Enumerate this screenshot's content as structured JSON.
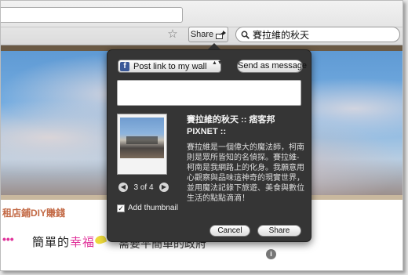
{
  "toolbar": {
    "share_label": "Share",
    "search_value": "賽拉維的秋天"
  },
  "page": {
    "blog_link": "租店鋪DIY賺錢",
    "pink_mark": "•••",
    "headline_pre": "簡單的",
    "headline_highlight": "幸福",
    "sub_head": "需要平簡單的政府",
    "info_icon_glyph": "i"
  },
  "popover": {
    "post_select_value": "Post link to my wall",
    "send_message_label": "Send as message",
    "message_placeholder": "",
    "link_title": "賽拉維的秋天 :: 痞客邦 PIXNET ::",
    "link_description": "賽拉維是一個偉大的魔法師，柯南則是眾所皆知的名偵探。賽拉維-柯南是我網路上的化身。我願意用心觀察與品味這神奇的現實世界，並用魔法記錄下旅遊、美食與數位生活的點點滴滴！",
    "thumb_counter": "3 of 4",
    "prev_glyph": "◀",
    "next_glyph": "▶",
    "add_thumbnail_label": "Add thumbnail",
    "add_thumbnail_checked": true,
    "checkbox_glyph": "✓",
    "cancel_label": "Cancel",
    "share_label": "Share"
  },
  "icons": {
    "star": "☆",
    "facebook": "f",
    "select_arrows": "▲▼"
  },
  "colors": {
    "popover_bg": "#353535",
    "facebook_blue": "#3b5998",
    "highlight_pink": "#e0329a",
    "blog_link_orange": "#c36a46"
  }
}
